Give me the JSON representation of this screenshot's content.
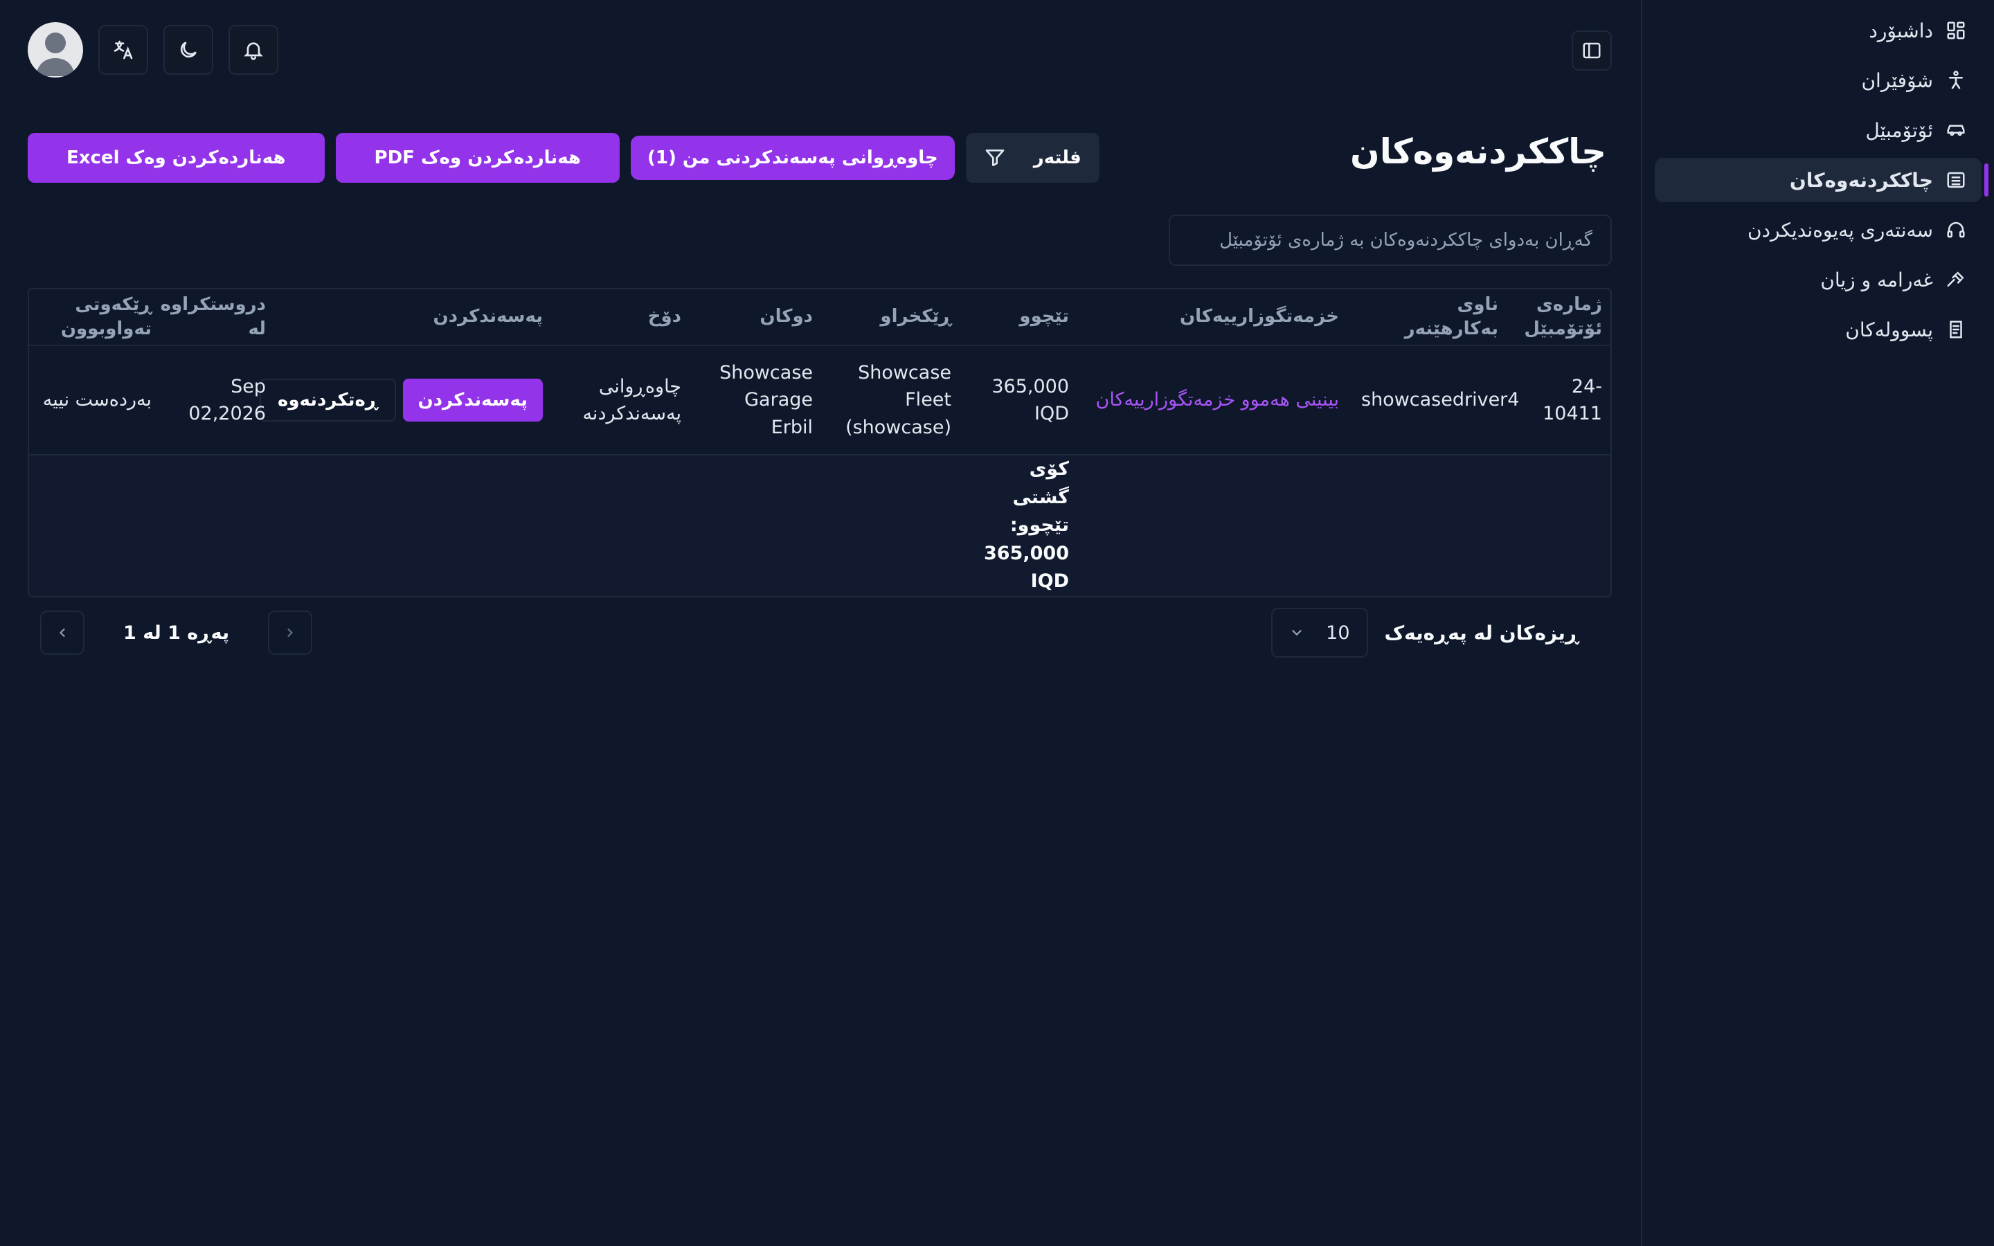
{
  "sidebar": {
    "items": [
      {
        "label": "داشبۆرد",
        "icon": "dashboard-icon"
      },
      {
        "label": "شۆفێران",
        "icon": "person-icon"
      },
      {
        "label": "ئۆتۆمبێل",
        "icon": "car-icon"
      },
      {
        "label": "چاککردنەوەکان",
        "icon": "archive-icon",
        "active": true
      },
      {
        "label": "سەنتەری پەیوەندیکردن",
        "icon": "headset-icon"
      },
      {
        "label": "غەرامە و زیان",
        "icon": "gavel-icon"
      },
      {
        "label": "پسوولەکان",
        "icon": "receipt-icon"
      }
    ]
  },
  "header": {
    "title": "چاککردنەوەکان",
    "filter_label": "فلتەر",
    "pending_label": "چاوەڕوانی پەسەندکردنی من (1)",
    "export_pdf_label": "هەناردەکردن وەک PDF",
    "export_excel_label": "هەناردەکردن وەک Excel"
  },
  "search": {
    "placeholder": "گەڕان بەدوای چاککردنەوەکان بە ژمارەی ئۆتۆمبێل"
  },
  "table": {
    "columns": [
      "ژمارەی ئۆتۆمبێل",
      "ناوی بەکارهێنەر",
      "خزمەتگوزارییەکان",
      "تێچوو",
      "ڕێکخراو",
      "دوکان",
      "دۆخ",
      "پەسەندکردن",
      "دروستکراوە لە",
      "ڕێکەوتی تەواوبوون"
    ],
    "rows": [
      {
        "plate": "24-10411",
        "username": "showcasedriver4",
        "services": "بینینی هەموو خزمەتگوزارییەکان",
        "cost": "365,000 IQD",
        "organization": "Showcase Fleet (showcase)",
        "shop": "Showcase Garage Erbil",
        "status": "چاوەڕوانی پەسەندکردنە",
        "approve_label": "پەسەندکردن",
        "reject_label": "ڕەتکردنەوە",
        "created_at": "Sep 02,2026",
        "completed_at": "بەردەست نییە"
      }
    ],
    "total_label": "کۆی گشتی تێچوو:",
    "total_value": "365,000 IQD"
  },
  "pagination": {
    "per_page_label": "ڕیزەکان لە پەڕەیەک",
    "per_page_value": "10",
    "page_info": "پەڕە 1 لە 1"
  },
  "colors": {
    "background": "#0f172a",
    "accent": "#9333ea",
    "link": "#a855f7",
    "border": "#1e293b"
  }
}
